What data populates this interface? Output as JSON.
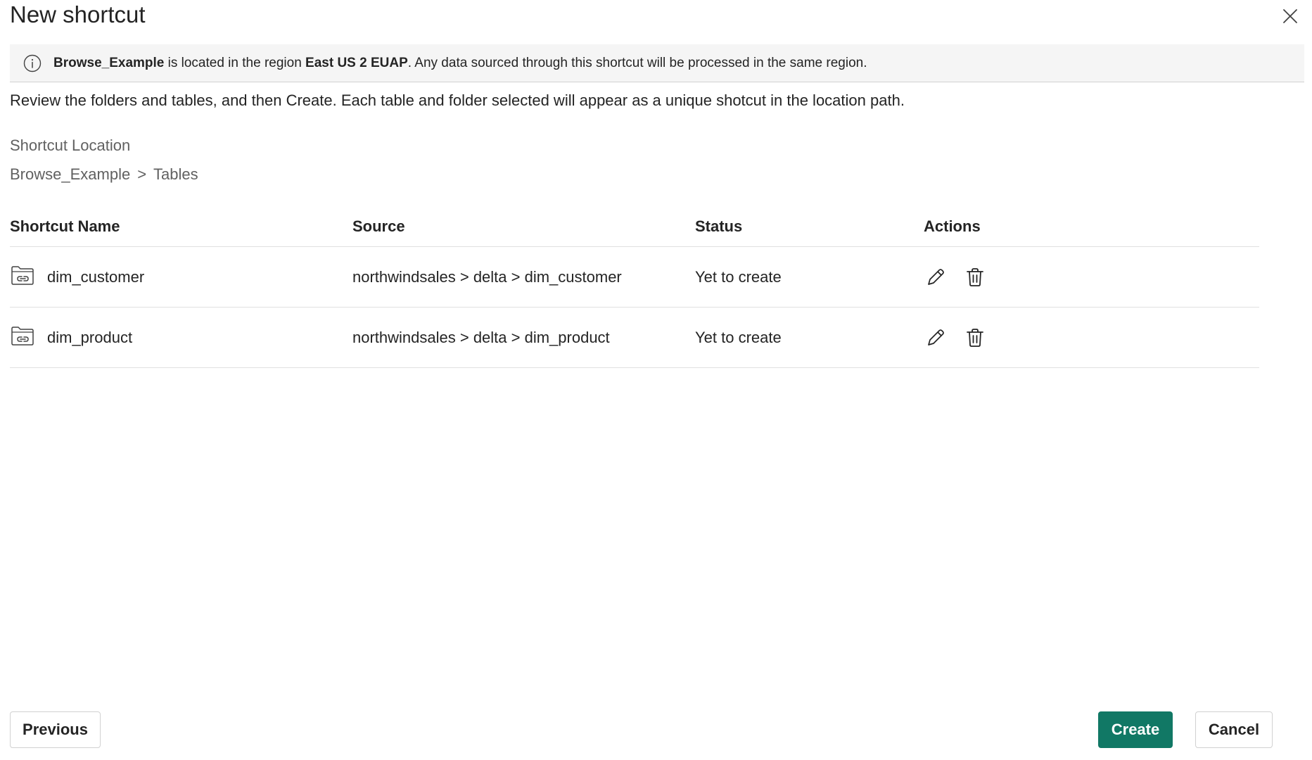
{
  "dialog": {
    "title": "New shortcut",
    "close_icon": "close-icon"
  },
  "info_bar": {
    "icon": "info-icon",
    "item_name": "Browse_Example",
    "text_1": " is located in the region ",
    "region": "East US 2 EUAP",
    "text_2": ". Any data sourced through this shortcut will be processed in the same region."
  },
  "description": "Review the folders and tables, and then Create. Each table and folder selected will appear as a unique shotcut in the location path.",
  "location": {
    "label": "Shortcut Location",
    "breadcrumb": [
      "Browse_Example",
      ">",
      "Tables"
    ]
  },
  "table": {
    "headers": {
      "name": "Shortcut Name",
      "source": "Source",
      "status": "Status",
      "actions": "Actions"
    },
    "rows": [
      {
        "name": "dim_customer",
        "source": "northwindsales > delta > dim_customer",
        "status": "Yet to create",
        "icon": "folder-link-icon"
      },
      {
        "name": "dim_product",
        "source": "northwindsales > delta > dim_product",
        "status": "Yet to create",
        "icon": "folder-link-icon"
      }
    ],
    "action_icons": [
      "edit-icon",
      "delete-icon"
    ]
  },
  "footer": {
    "previous_label": "Previous",
    "create_label": "Create",
    "cancel_label": "Cancel"
  },
  "colors": {
    "primary": "#117865",
    "info_bar_bg": "#f5f5f5",
    "muted_text": "#616161"
  }
}
